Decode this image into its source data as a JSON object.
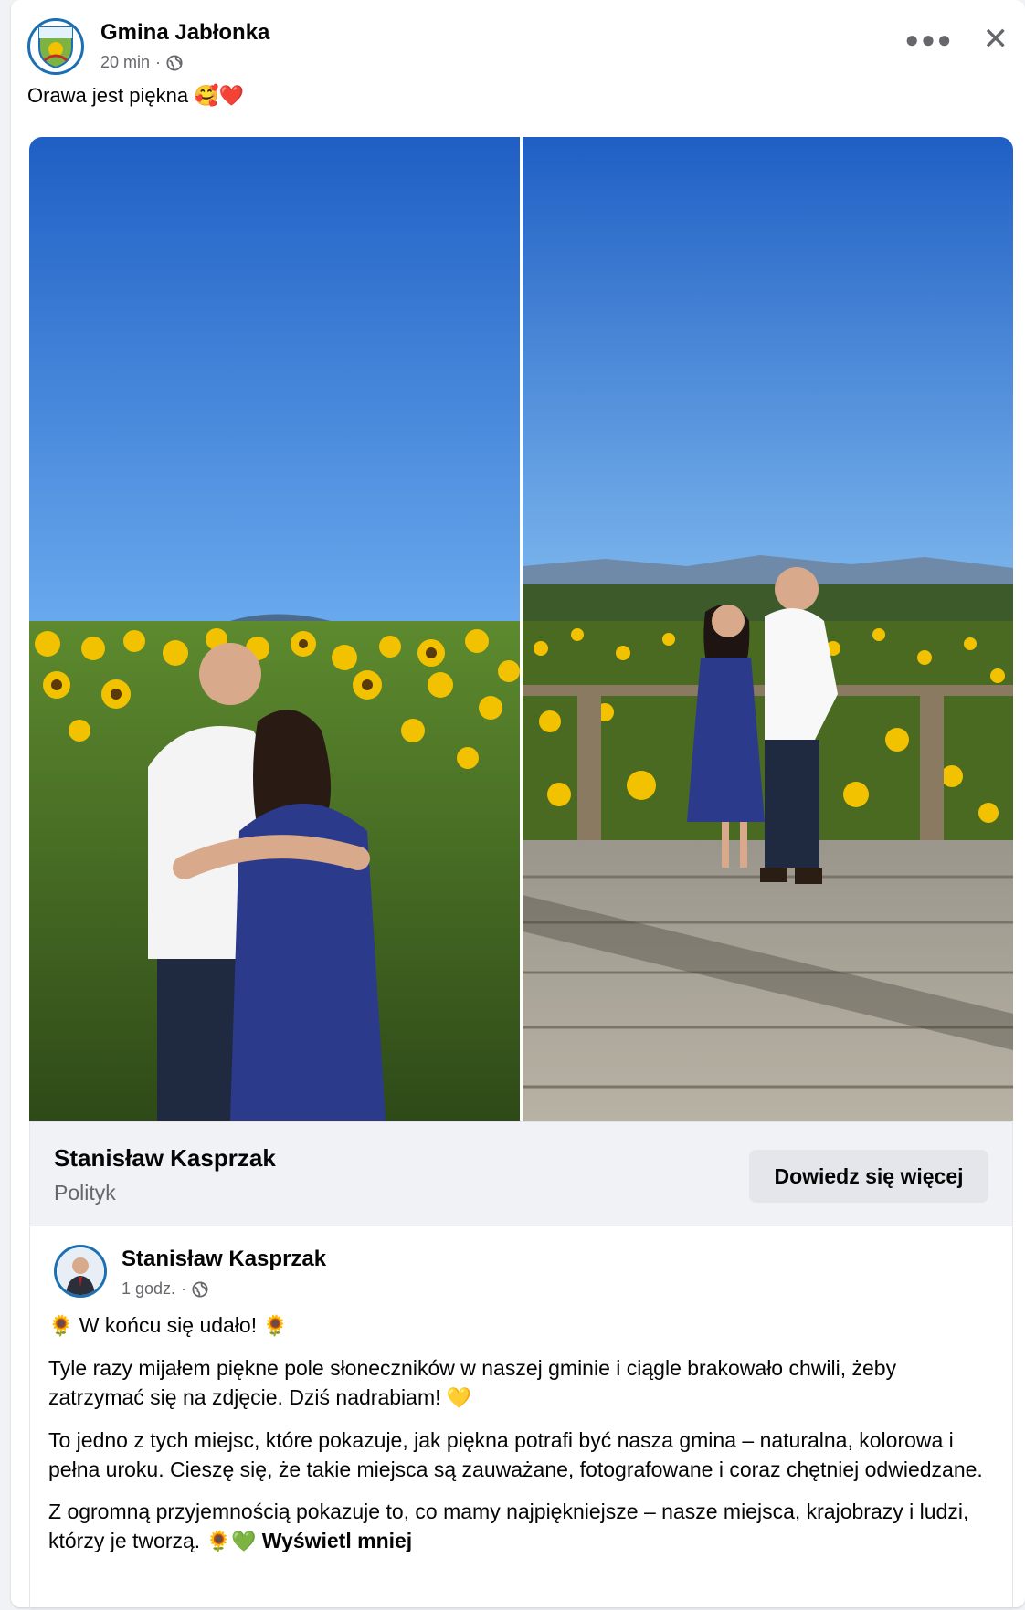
{
  "post": {
    "page_name": "Gmina Jabłonka",
    "time": "20 min",
    "separator": "·",
    "caption": "Orawa jest piękna",
    "caption_emoji": "🥰❤️"
  },
  "icons": {
    "more": "more-options-icon",
    "close": "close-icon",
    "audience": "globe-icon"
  },
  "cta": {
    "name": "Stanisław Kasprzak",
    "subtitle": "Polityk",
    "button_label": "Dowiedz się więcej"
  },
  "shared_post": {
    "author": "Stanisław Kasprzak",
    "time": "1 godz.",
    "separator": "·",
    "headline_emoji": "🌻",
    "headline": "W końcu się udało!",
    "paragraph1": "Tyle razy mijałem piękne pole słoneczników w naszej gminie i ciągle brakowało chwili, żeby zatrzymać się na zdjęcie. Dziś nadrabiam!",
    "paragraph1_emoji": "💛",
    "paragraph2": "To jedno z tych miejsc, które pokazuje, jak piękna potrafi być nasza gmina – naturalna, kolorowa i pełna uroku. Cieszę się, że takie miejsca są zauważane, fotografowane i coraz chętniej odwiedzane.",
    "paragraph3": "Z ogromną przyjemnością pokazuje to, co mamy najpiękniejsze – nasze miejsca, krajobrazy i ludzi, którzy je tworzą.",
    "paragraph3_emoji": "🌻💚",
    "toggle_label": "Wyświetl mniej"
  },
  "colors": {
    "accent": "#1b6fb5",
    "sky_top": "#1f5fc4",
    "sky_bottom": "#5fa3e6",
    "sunflower": "#f2c200",
    "dress": "#2c3a8c"
  }
}
